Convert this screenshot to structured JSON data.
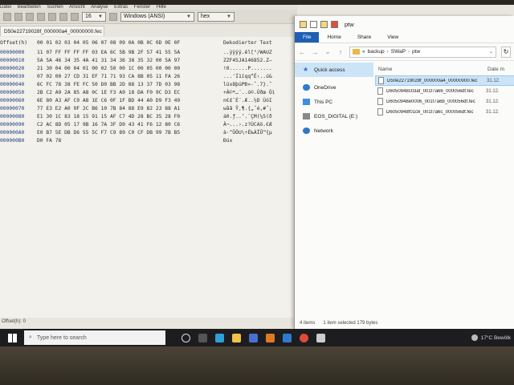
{
  "hexeditor": {
    "menu": [
      "Datei",
      "Bearbeiten",
      "Suchen",
      "Ansicht",
      "Analyse",
      "Extras",
      "Fenster",
      "Hilfe"
    ],
    "toolbar": {
      "bytes_per_row": "16",
      "charset": "Windows (ANSI)",
      "mode": "hex"
    },
    "file_tab": "D50e22719028f_000000a4_00000000.fec",
    "header": {
      "offset_label": "Offset(h)",
      "columns": "00 01 02 03 04 05 06 07 08 09 0A 0B 0C 0D 0E 0F",
      "decoded_label": "Dekodierter Text"
    },
    "rows": [
      {
        "off": "00000000",
        "bytes": "11 07 FF FF FF FF 03 EA 6C 5B 9B 2F 57 41 55 5A",
        "dec": "..ÿÿÿÿ.êl[°/WAUZ"
      },
      {
        "off": "00000010",
        "bytes": "5A 5A 46 34 35 4A 41 31 34 36 38 35 32 00 5A 97",
        "dec": "ZZF45JA146852.Z—"
      },
      {
        "off": "00000020",
        "bytes": "21 30 04 00 04 01 00 02 50 00 1C 00 05 00 00 00",
        "dec": "!0......P......."
      },
      {
        "off": "00000030",
        "bytes": "07 02 00 27 CD 31 EF 71 71 93 CA 8B 05 11 FA 26",
        "dec": "...'Í1ïqq“Ê‹..ú&"
      },
      {
        "off": "00000040",
        "bytes": "6C FC 78 38 FE FC 50 D0 BB 2D 88 13 37 7D 03 98",
        "dec": "lüx8þüPÐ»-ˆ.7}.˜"
      },
      {
        "off": "00000050",
        "bytes": "2B C2 A9 2A 85 A8 0C 1E F3 A9 18 DA F0 9C D3 EC",
        "dec": "+Â©*…¨..ó©.Úðœ Óì"
      },
      {
        "off": "00000060",
        "bytes": "6E 80 A3 AF C9 A8 1E C6 0F 1F BD 44 A0 D9 F3 49",
        "dec": "n€£¯É¨.Æ..½D ÙóI"
      },
      {
        "off": "00000070",
        "bytes": "77 E3 E2 A0 9F 2C B6 10 7B 84 88 E9 82 23 88 A1",
        "dec": "wãâ Ÿ,¶.{„ˆé‚#ˆ¡"
      },
      {
        "off": "00000080",
        "bytes": "E1 30 1C 83 18 15 91 15 AF C7 4D 28 BC 35 28 F0",
        "dec": "á0.ƒ..‘.¯ÇM(¼5(ð"
      },
      {
        "off": "00000090",
        "bytes": "C2 AC 8D 05 17 9B 16 7A 3F D9 43 41 F6 12 80 C6",
        "dec": "Â¬...›.z?ÙCAö.€Æ"
      },
      {
        "off": "000000A0",
        "bytes": "E0 B7 5E DB D6 55 5C F7 C9 89 C0 CF DB 99 7B B5",
        "dec": "à·^ÛÖU\\÷É‰ÀÏÛ™{µ"
      },
      {
        "off": "000000B0",
        "bytes": "D0 FA 78",
        "dec": "Ðúx"
      }
    ],
    "status": "Offset(h): 0"
  },
  "explorer": {
    "title": "ptw",
    "ribbon_tabs": [
      "File",
      "Home",
      "Share",
      "View"
    ],
    "address": [
      "«",
      "backup",
      "SWaP",
      "ptw"
    ],
    "nav_items": [
      {
        "label": "Quick access",
        "icon": "star-icon"
      },
      {
        "label": "OneDrive",
        "icon": "cloud-icon"
      },
      {
        "label": "This PC",
        "icon": "pc-icon"
      },
      {
        "label": "EOS_DIGITAL (E:)",
        "icon": "drive-icon"
      },
      {
        "label": "Network",
        "icon": "network-icon"
      }
    ],
    "columns": {
      "name": "Name",
      "date": "Date m"
    },
    "files": [
      {
        "name": "D50e22719028f_000000a4_00000000.fec",
        "date": "31.12.",
        "selected": true
      },
      {
        "name": "D6050948c03af_001f7a66_000056df.fec",
        "date": "31.12.",
        "selected": false
      },
      {
        "name": "D6050948e0006_001f7a6b_000056df.fec",
        "date": "31.12.",
        "selected": false
      },
      {
        "name": "D6050948f01c6_001f7a6c_000056df.fec",
        "date": "31.12.",
        "selected": false
      }
    ],
    "status": {
      "items": "4 items",
      "selected": "1 item selected  179 bytes"
    }
  },
  "taskbar": {
    "search_placeholder": "Type here to search",
    "weather": "17°C  Bewölk"
  }
}
